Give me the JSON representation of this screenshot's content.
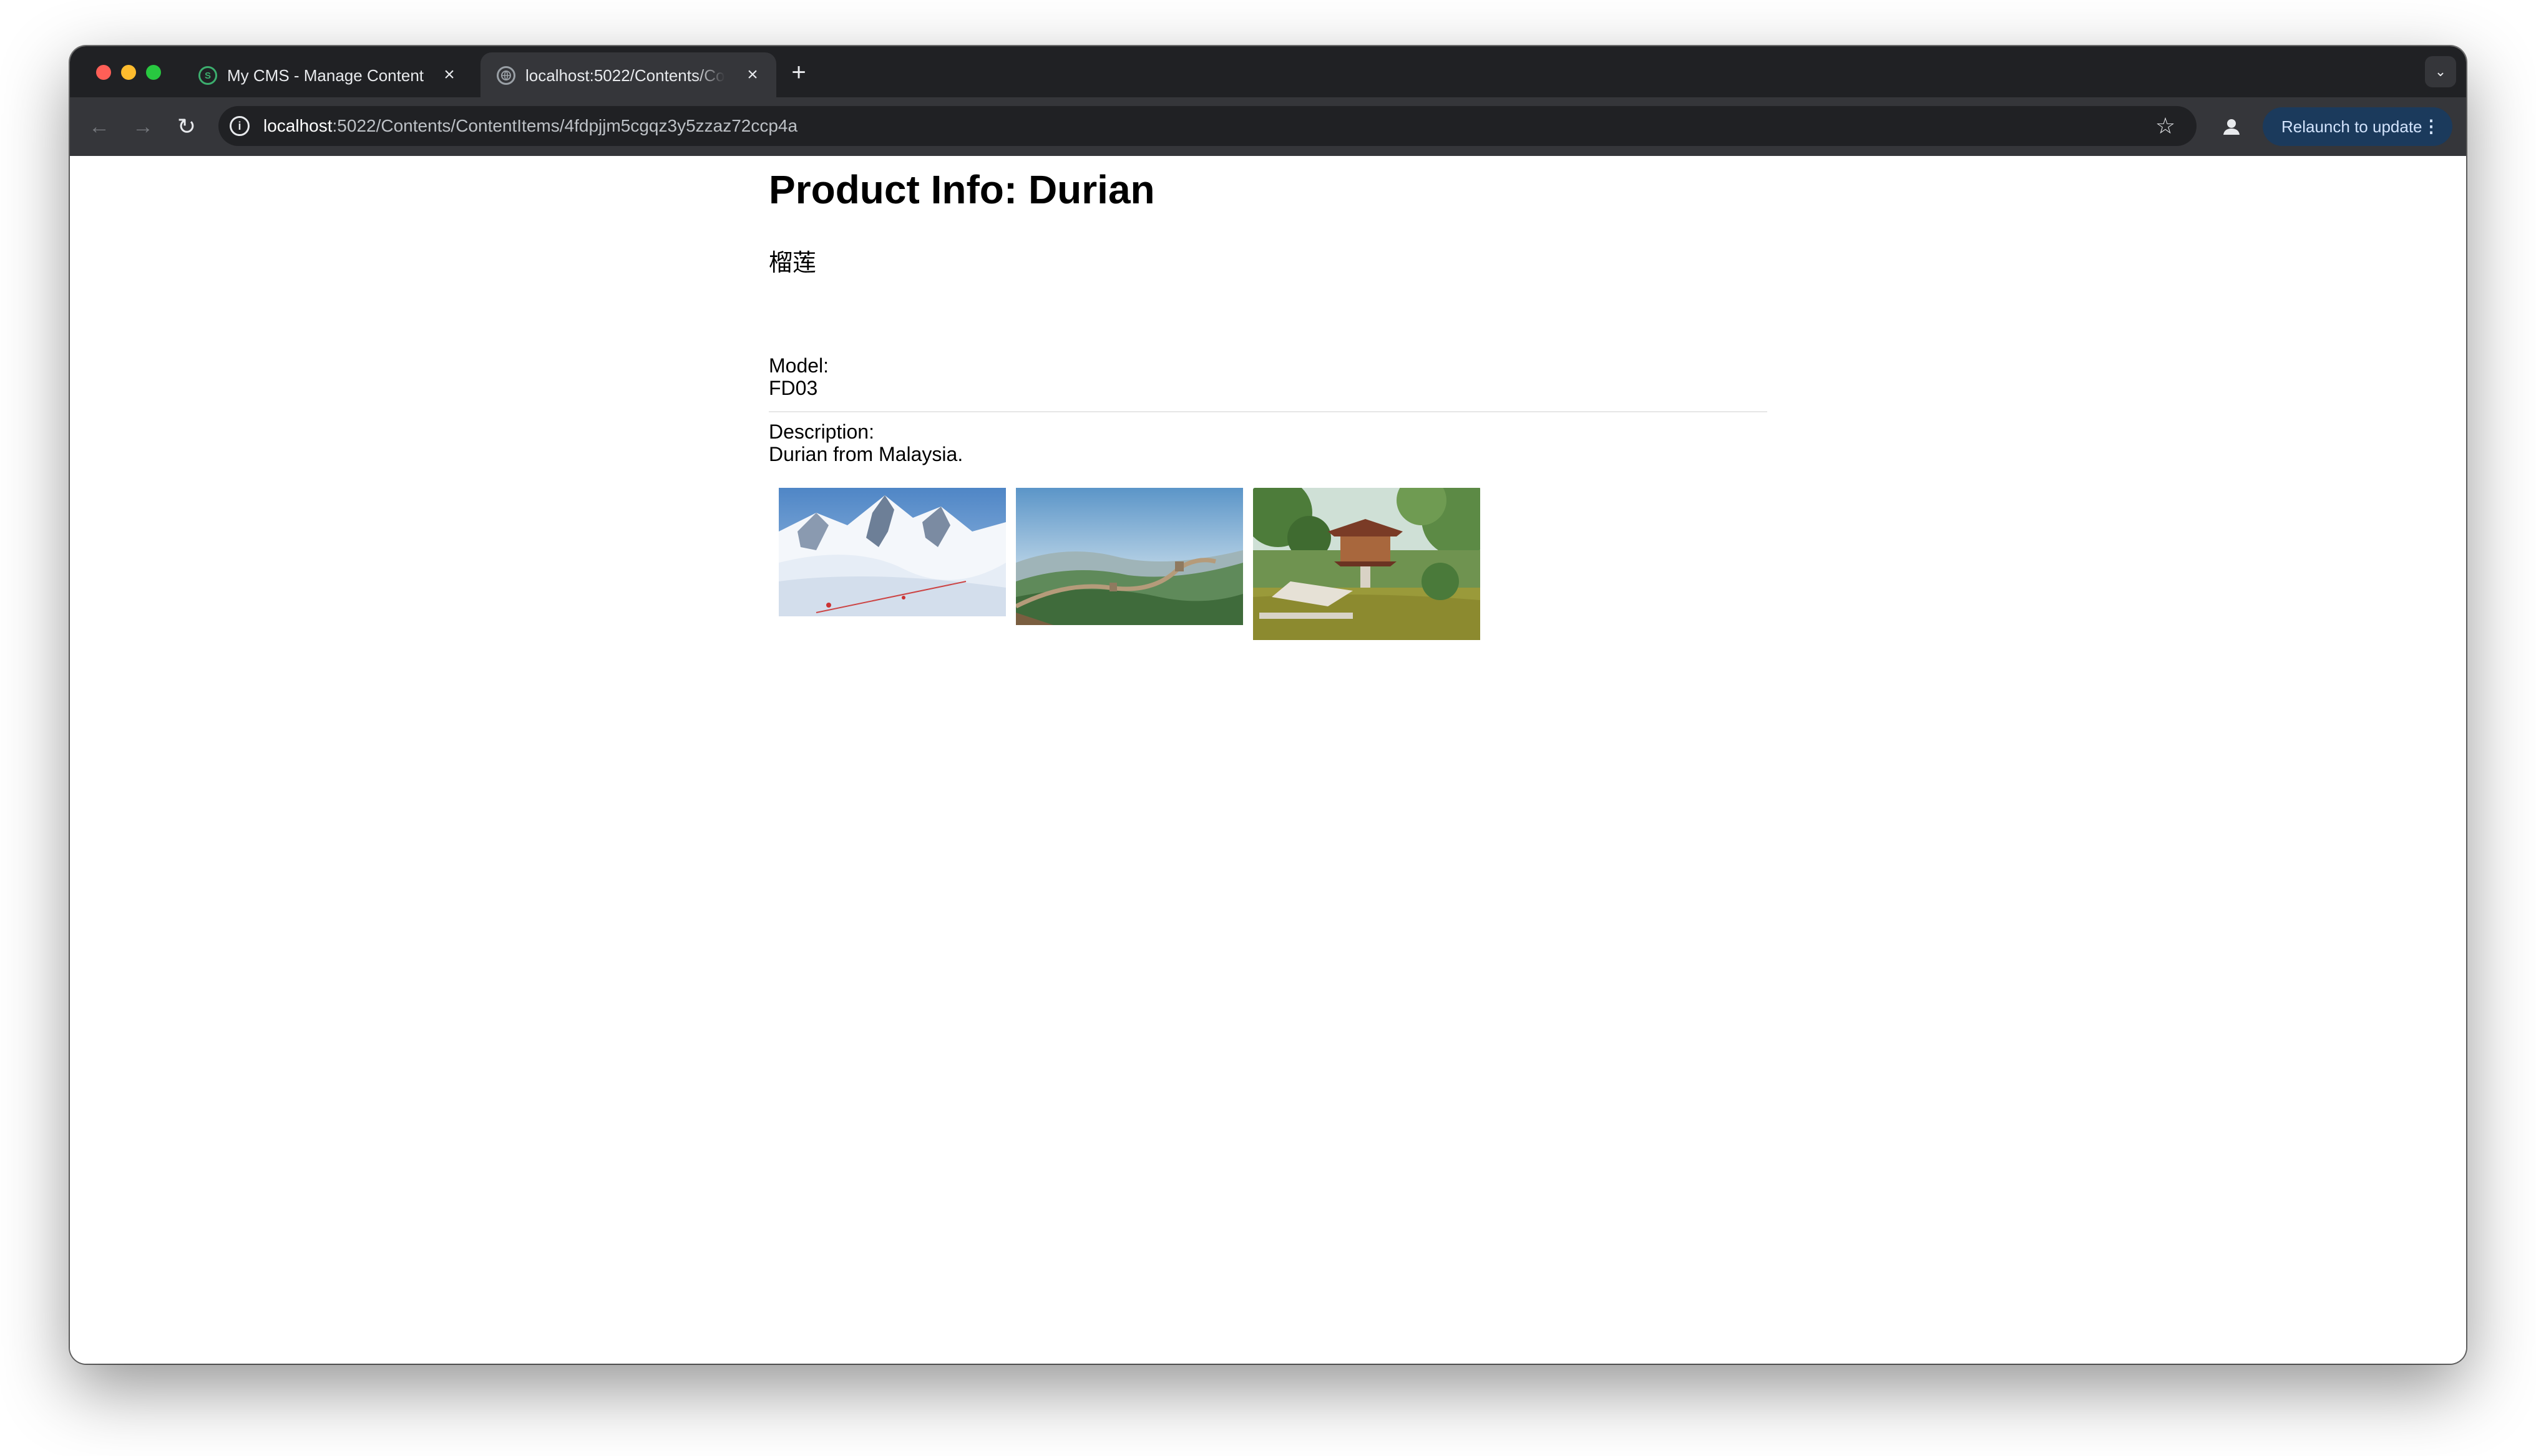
{
  "browser": {
    "tabs": [
      {
        "title": "My CMS - Manage Content",
        "favicon": "cms-logo-icon",
        "active": false
      },
      {
        "title": "localhost:5022/Contents/ContentItems/4fdpjjm5cgqz3y5zzaz72ccp4a",
        "favicon": "globe-icon",
        "active": true
      }
    ],
    "url_host": "localhost",
    "url_rest": ":5022/Contents/ContentItems/4fdpjjm5cgqz3y5zzaz72ccp4a",
    "relaunch_label": "Relaunch to update",
    "accent_color": "#1b3a5c"
  },
  "product": {
    "title": "Product Info: Durian",
    "chinese_name": "榴莲",
    "model_label": "Model:",
    "model_value": "FD03",
    "description_label": "Description:",
    "description_value": "Durian from Malaysia."
  },
  "images": [
    {
      "name": "snowy-mountain-image",
      "subject": "snowy mountains"
    },
    {
      "name": "great-wall-image",
      "subject": "great wall on green hills"
    },
    {
      "name": "pagoda-garden-image",
      "subject": "one pillar pagoda with pond"
    }
  ]
}
